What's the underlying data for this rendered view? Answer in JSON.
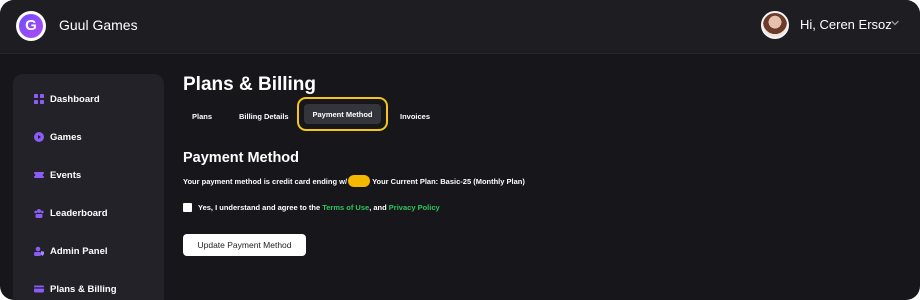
{
  "app": {
    "title": "Guul Games",
    "logo_letter": "G"
  },
  "user": {
    "greeting": "Hi, Ceren Ersoz"
  },
  "sidebar": {
    "items": [
      {
        "label": "Dashboard",
        "icon": "grid-icon"
      },
      {
        "label": "Games",
        "icon": "play-circle-icon"
      },
      {
        "label": "Events",
        "icon": "ticket-icon"
      },
      {
        "label": "Leaderboard",
        "icon": "users-icon"
      },
      {
        "label": "Admin Panel",
        "icon": "user-shield-icon"
      },
      {
        "label": "Plans & Billing",
        "icon": "credit-card-icon"
      }
    ]
  },
  "page": {
    "title": "Plans & Billing"
  },
  "tabs": [
    {
      "label": "Plans"
    },
    {
      "label": "Billing Details"
    },
    {
      "label": "Payment Method",
      "active": true
    },
    {
      "label": "Invoices"
    }
  ],
  "payment": {
    "title": "Payment Method",
    "card_text": "Your payment method is credit card ending w/",
    "plan_text": "Your Current Plan: Basic-25 (Monthly Plan)",
    "agree_prefix": "Yes, I understand and agree to the",
    "terms_link": "Terms of Use",
    "agree_middle": ", and",
    "privacy_link": "Privacy Policy",
    "update_button": "Update Payment Method"
  },
  "colors": {
    "background": "#17171b",
    "sidebar": "#222228",
    "accent_purple": "#8b5cf6",
    "highlight_yellow": "#f5c518",
    "link_green": "#2ec45c"
  }
}
